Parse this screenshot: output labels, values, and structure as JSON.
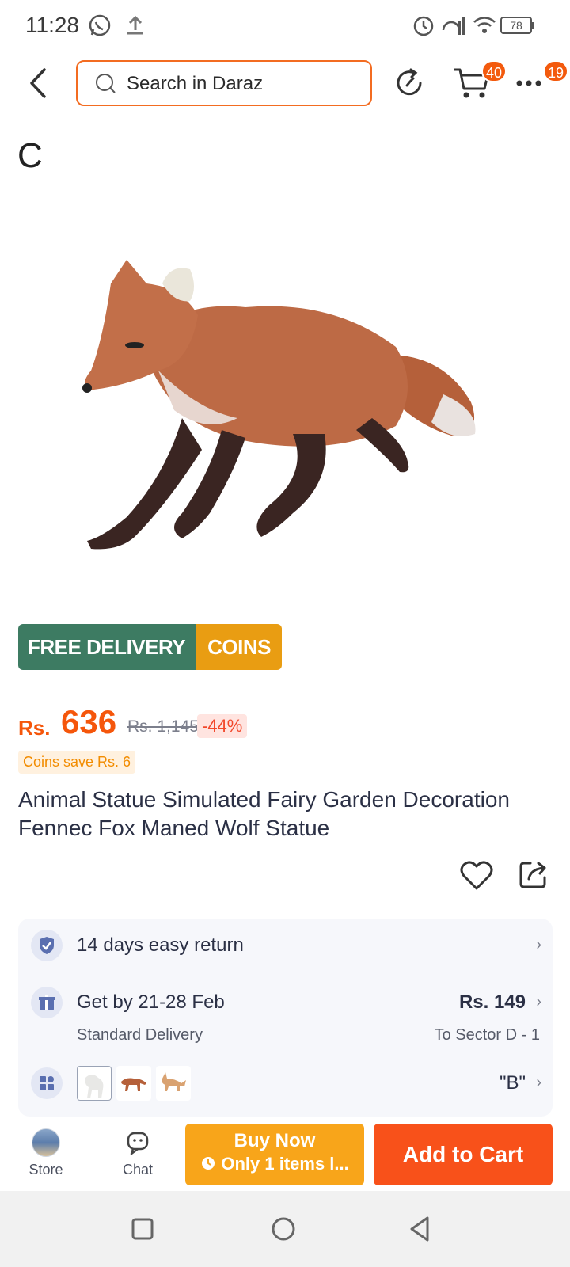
{
  "status_bar": {
    "time": "11:28",
    "battery": "78"
  },
  "header": {
    "search_placeholder": "Search in Daraz",
    "cart_count": "40",
    "more_count": "19"
  },
  "stray_text": "C",
  "promo": {
    "free_delivery": "FREE DELIVERY",
    "coins": "COINS",
    "free_color": "#3d7b62",
    "coins_color": "#e99d12"
  },
  "price": {
    "currency": "Rs.",
    "current": "636",
    "original": "Rs. 1,145",
    "discount": "-44%",
    "coins_save": "Coins save Rs. 6",
    "accent": "#f5560b"
  },
  "product": {
    "title": "Animal Statue Simulated Fairy Garden Decoration Fennec Fox Maned Wolf Statue"
  },
  "services": {
    "return_text": "14 days easy return",
    "delivery_text": "Get by 21-28 Feb",
    "delivery_sub": "Standard Delivery",
    "delivery_price": "Rs. 149",
    "delivery_location": "To Sector D - 1",
    "variant_selected": "\"B\""
  },
  "bottom_bar": {
    "store_label": "Store",
    "chat_label": "Chat",
    "buy_now_label": "Buy Now",
    "buy_now_sub": "Only 1 items l...",
    "add_to_cart_label": "Add to Cart",
    "buy_now_color": "#f8a51a",
    "add_to_cart_color": "#f8511a"
  }
}
